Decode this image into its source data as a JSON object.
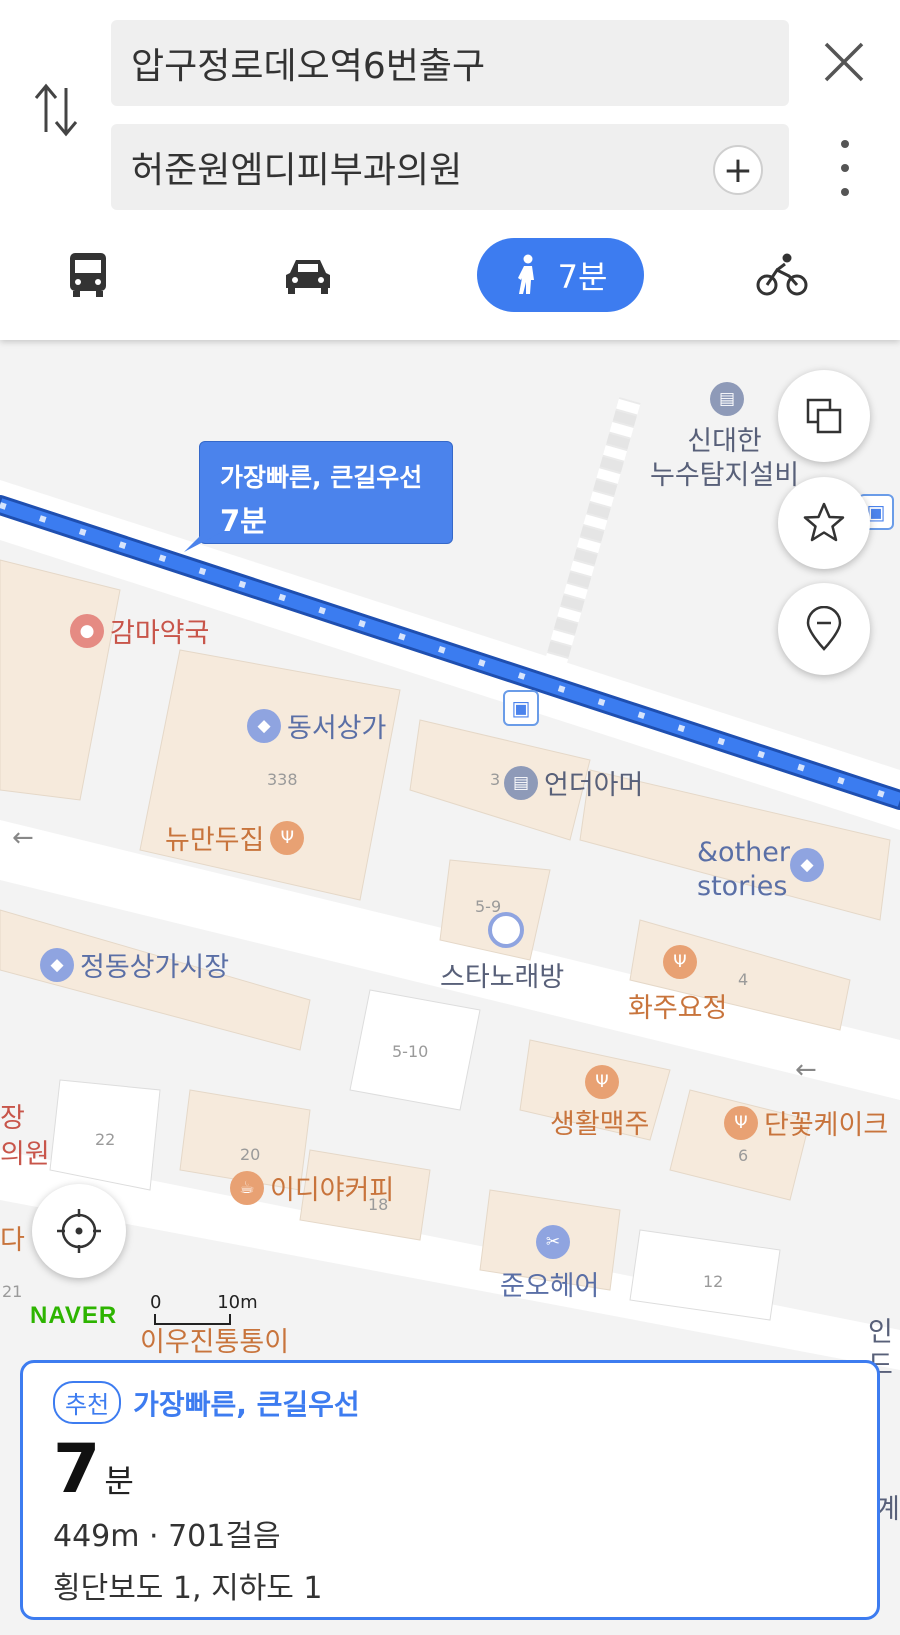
{
  "search": {
    "origin": "압구정로데오역6번출구",
    "destination": "허준원엠디피부과의원"
  },
  "modes": {
    "walk_time": "7분"
  },
  "map": {
    "route_label_title": "가장빠른, 큰길우선",
    "route_label_time": "7분",
    "pois": {
      "gamma_pharmacy": "감마약국",
      "dongseo_mall": "동서상가",
      "nyu_mandu": "뉴만두집",
      "under_armour": "언더아머",
      "other_stories_1": "&other",
      "other_stories_2": "stories",
      "jeongdong_market": "정동상가시장",
      "star_noraebang": "스타노래방",
      "hwaju_yojeong": "화주요정",
      "saenghwal_maekju": "생활맥주",
      "dankkot_cake": "단꽃케이크",
      "ediya": "이디야커피",
      "junoh_hair": "준오헤어",
      "shindaehan_1": "신대한",
      "shindaehan_2": "누수탐지설비",
      "ioojin": "이우진통통이",
      "left_partial_1": "장",
      "left_partial_2": "의원",
      "left_partial_3": "다",
      "right_partial_1": "인",
      "right_partial_2": "드",
      "right_partial_3": "계"
    },
    "building_numbers": {
      "n338": "338",
      "n3": "3",
      "n59": "5-9",
      "n510": "5-10",
      "n4": "4",
      "n22": "22",
      "n20": "20",
      "n18": "18",
      "n6": "6",
      "n12": "12",
      "n21": "21"
    },
    "brand": "NAVER",
    "scale_zero": "0",
    "scale_label": "10m"
  },
  "summary": {
    "badge": "추천",
    "title": "가장빠른, 큰길우선",
    "time_value": "7",
    "time_unit": "분",
    "distance": "449m · 701걸음",
    "crossings": "횡단보도 1, 지하도 1"
  },
  "colors": {
    "accent": "#3d7cf0",
    "route": "#2f6fe8"
  }
}
